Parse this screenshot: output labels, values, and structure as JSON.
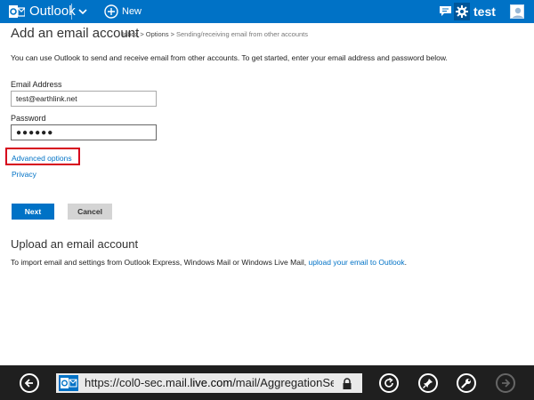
{
  "topbar": {
    "brand": "Outlook",
    "new_label": "New",
    "user_name": "test",
    "accent_color": "#0072c6",
    "icons": [
      "outlook-logo-icon",
      "chevron-down-icon",
      "plus-circle-icon",
      "chat-icon",
      "gear-icon",
      "avatar-icon"
    ]
  },
  "page": {
    "title": "Add an email account",
    "breadcrumb": {
      "items": [
        "Inbox",
        "Options"
      ],
      "current": "Sending/receiving email from other accounts"
    },
    "intro": "You can use Outlook to send and receive email from other accounts. To get started, enter your email address and password below."
  },
  "form": {
    "email_label": "Email Address",
    "email_value": "test@earthlink.net",
    "password_label": "Password",
    "password_value": "●●●●●●",
    "advanced_options_link": "Advanced options",
    "privacy_link": "Privacy",
    "next_label": "Next",
    "cancel_label": "Cancel"
  },
  "upload": {
    "heading": "Upload an email account",
    "text": "To import email and settings from Outlook Express, Windows Mail or Windows Live Mail,",
    "link": "upload your email to Outlook",
    "end": "."
  },
  "browser": {
    "url_prefix": "https://col0-sec.mail.",
    "url_domain": "live.com",
    "url_suffix": "/mail/AggregationSetup",
    "icons": [
      "back-icon",
      "lock-icon",
      "refresh-icon",
      "pin-icon",
      "tools-icon",
      "forward-icon"
    ]
  }
}
